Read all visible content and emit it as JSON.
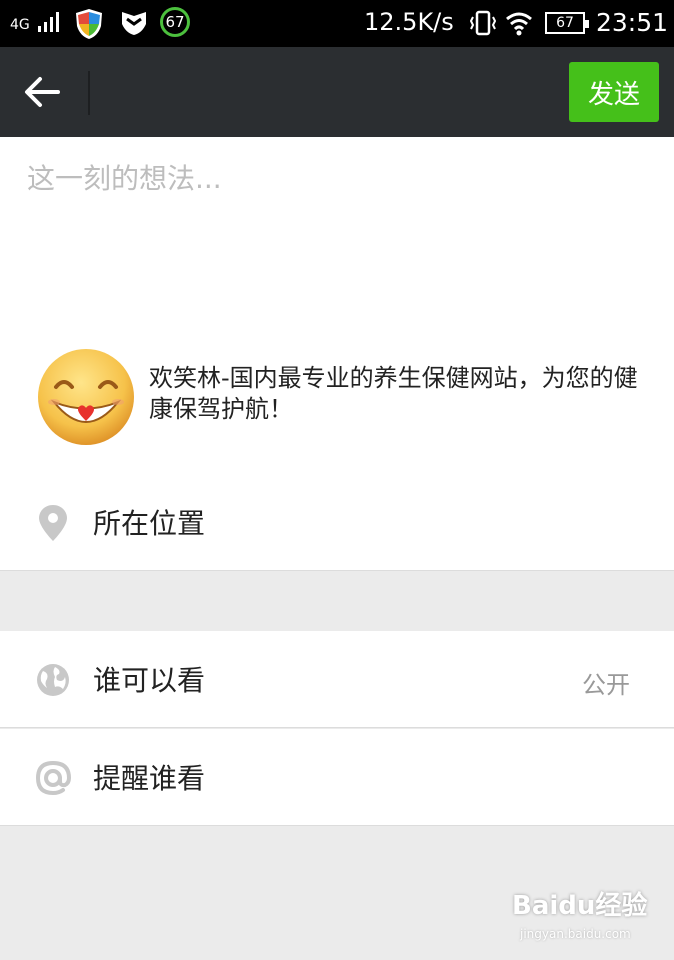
{
  "status_bar": {
    "network": "4G",
    "battery_badge": "67",
    "speed": "12.5K/s",
    "battery_level": "67",
    "time": "23:51"
  },
  "toolbar": {
    "back_icon": "arrow-left-icon",
    "send_label": "发送",
    "send_color": "#45c01a"
  },
  "compose": {
    "placeholder": "这一刻的想法...",
    "share_text": "欢笑林-国内最专业的养生保健网站，为您的健康保驾护航！",
    "share_icon": "smiley-icon"
  },
  "options": {
    "location_label": "所在位置",
    "visibility_label": "谁可以看",
    "visibility_value": "公开",
    "remind_label": "提醒谁看"
  },
  "watermark": {
    "brand": "Baidu经验",
    "url": "jingyan.baidu.com"
  }
}
